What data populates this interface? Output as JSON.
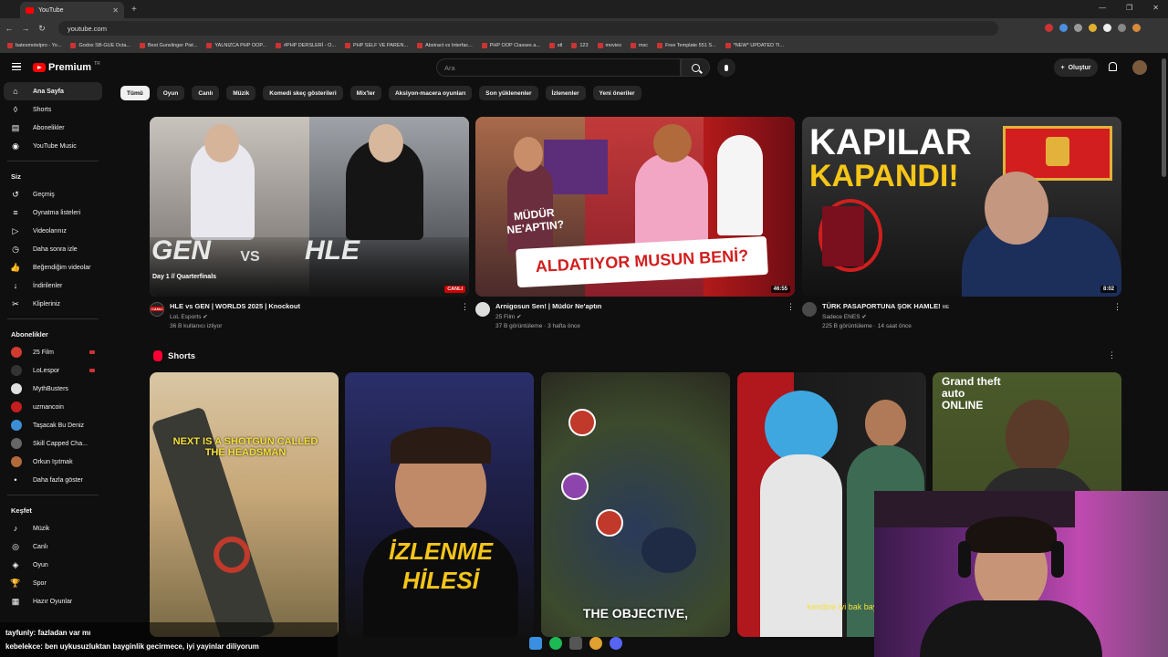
{
  "browser": {
    "tab_title": "YouTube",
    "url": "youtube.com",
    "bookmarks": [
      "batesmotelpro - Yo...",
      "Godox SB-GUE Octa...",
      "Best Gunslinger Pist...",
      "YALNIZCA PHP OOP...",
      "#PHP DERSLERİ - O...",
      "PHP SELF VE PAREN...",
      "Abstract vs Interfac...",
      "PHP OOP Classes a...",
      "stl",
      "123",
      "movies",
      "msc",
      "Free Template 551 S...",
      "*NEW* UPDATED TI..."
    ]
  },
  "masthead": {
    "logo_text": "Premium",
    "logo_sup": "TR",
    "search_placeholder": "Ara",
    "create_label": "Oluştur"
  },
  "sidebar": {
    "main": [
      {
        "label": "Ana Sayfa",
        "icon": "home-icon"
      },
      {
        "label": "Shorts",
        "icon": "shorts-icon"
      },
      {
        "label": "Abonelikler",
        "icon": "subscriptions-icon"
      },
      {
        "label": "YouTube Music",
        "icon": "music-icon"
      }
    ],
    "you_header": "Siz",
    "you": [
      {
        "label": "Geçmiş",
        "icon": "history-icon"
      },
      {
        "label": "Oynatma listeleri",
        "icon": "playlist-icon"
      },
      {
        "label": "Videolarınız",
        "icon": "your-videos-icon"
      },
      {
        "label": "Daha sonra izle",
        "icon": "watch-later-icon"
      },
      {
        "label": "Beğendiğim videolar",
        "icon": "like-icon"
      },
      {
        "label": "İndirilenler",
        "icon": "download-icon"
      },
      {
        "label": "Klipleriniz",
        "icon": "clips-icon"
      }
    ],
    "subs_header": "Abonelikler",
    "subs": [
      {
        "label": "25 Film",
        "color": "#d23b2f",
        "live": true
      },
      {
        "label": "LoLespor",
        "color": "#333333",
        "live": true
      },
      {
        "label": "MythBusters",
        "color": "#e0e0e0",
        "live": false
      },
      {
        "label": "uzmancoin",
        "color": "#c41e1e",
        "live": false
      },
      {
        "label": "Taşacak Bu Deniz",
        "color": "#3c8fd6",
        "live": false
      },
      {
        "label": "Skill Capped Cha...",
        "color": "#666666",
        "live": false
      },
      {
        "label": "Orkun Işıtmak",
        "color": "#b36a3a",
        "live": false
      }
    ],
    "more_label": "Daha fazla göster",
    "explore_header": "Keşfet",
    "explore": [
      {
        "label": "Müzik",
        "icon": "music-note-icon"
      },
      {
        "label": "Canlı",
        "icon": "live-icon"
      },
      {
        "label": "Oyun",
        "icon": "gaming-icon"
      },
      {
        "label": "Spor",
        "icon": "trophy-icon"
      },
      {
        "label": "Hazır Oyunlar",
        "icon": "playables-icon"
      }
    ]
  },
  "chips": [
    "Tümü",
    "Oyun",
    "Canlı",
    "Müzik",
    "Komedi skeç gösterileri",
    "Mix'ler",
    "Aksiyon-macera oyunları",
    "Son yüklenenler",
    "İzlenenler",
    "Yeni öneriler"
  ],
  "videos": [
    {
      "title": "HLE vs GEN | WORLDS 2025 | Knockout",
      "channel": "LoL Esports",
      "meta": "36 B kullanıcı izliyor",
      "badge": "CANLI",
      "thumb_left": "GEN",
      "thumb_vs": "VS",
      "thumb_right": "HLE",
      "thumb_sub": "Day 1 // Quarterfinals",
      "avatar_text": "CANLI"
    },
    {
      "title": "Arnigosun Sen! | Müdür Ne'aptın",
      "channel": "25 Film",
      "meta": "37 B görüntüleme · 3 hafta önce",
      "duration": "46:55",
      "thumb_banner": "ALDATIYOR MUSUN BENİ?",
      "thumb_side": "MÜDÜR NE'APTIN?"
    },
    {
      "title": "TÜRK PASAPORTUNA ŞOK HAMLE!",
      "title_suffix": "ME",
      "channel": "Sadece ENES",
      "meta": "225 B görüntüleme · 14 saat önce",
      "duration": "8:02",
      "thumb_line1": "KAPILAR",
      "thumb_line2": "KAPANDI!"
    }
  ],
  "shorts": {
    "header": "Shorts",
    "items": [
      {
        "text": "NEXT IS A SHOTGUN CALLED THE HEADSMAN"
      },
      {
        "text": "İZLENME HİLESİ"
      },
      {
        "text": "THE OBJECTIVE,"
      },
      {
        "text": "kendine iyi bak bay"
      },
      {
        "text": "Grand theft auto ONLINE"
      }
    ]
  },
  "chat": [
    {
      "user": "tayfunly",
      "message": ": fazladan var mı"
    },
    {
      "user": "kebelekce",
      "message": ": ben uykusuzluktan bayginlik gecirmece, iyi yayinlar diliyorum"
    }
  ]
}
